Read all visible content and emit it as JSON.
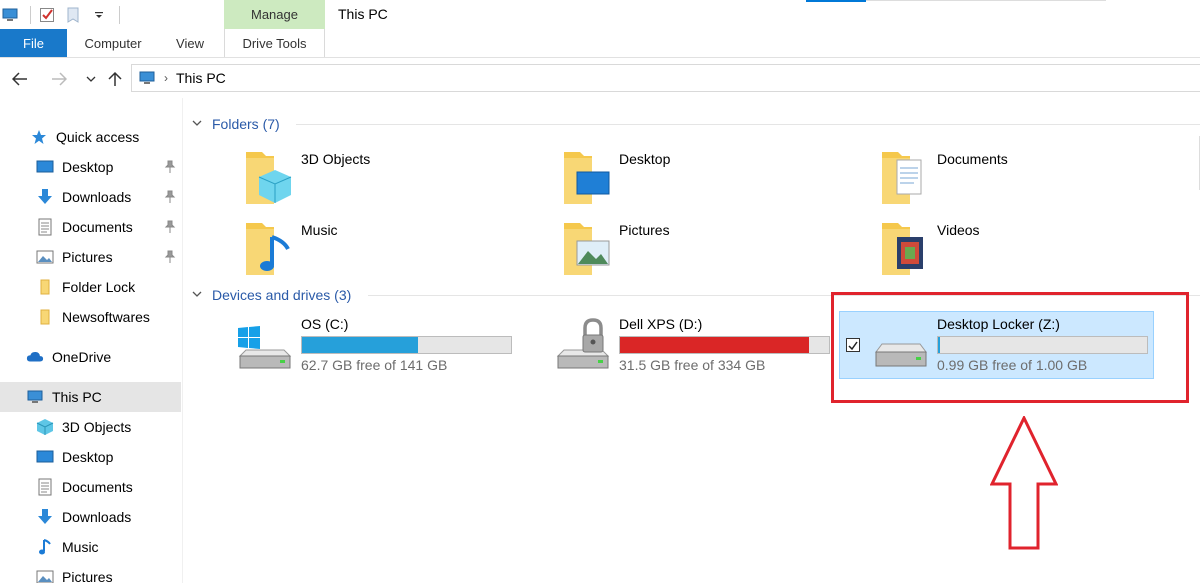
{
  "window": {
    "title": "This PC",
    "manage_tab": "Manage"
  },
  "ribbon": {
    "tabs": [
      {
        "label": "File"
      },
      {
        "label": "Computer"
      },
      {
        "label": "View"
      },
      {
        "label": "Drive Tools"
      }
    ]
  },
  "address": {
    "crumb": "This PC"
  },
  "sidebar": {
    "items": [
      {
        "label": "Quick access",
        "icon": "star-icon",
        "pinned": false
      },
      {
        "label": "Desktop",
        "icon": "desktop-icon",
        "pinned": true
      },
      {
        "label": "Downloads",
        "icon": "download-arrow-icon",
        "pinned": true
      },
      {
        "label": "Documents",
        "icon": "document-icon",
        "pinned": true
      },
      {
        "label": "Pictures",
        "icon": "pictures-icon",
        "pinned": true
      },
      {
        "label": "Folder Lock",
        "icon": "folder-icon",
        "pinned": false
      },
      {
        "label": "Newsoftwares",
        "icon": "folder-icon",
        "pinned": false
      },
      {
        "label": "OneDrive",
        "icon": "cloud-icon",
        "pinned": false
      },
      {
        "label": "This PC",
        "icon": "computer-icon",
        "pinned": false,
        "selected": true
      },
      {
        "label": "3D Objects",
        "icon": "cube-icon",
        "pinned": false
      },
      {
        "label": "Desktop",
        "icon": "desktop-icon",
        "pinned": false
      },
      {
        "label": "Documents",
        "icon": "document-icon",
        "pinned": false
      },
      {
        "label": "Downloads",
        "icon": "download-arrow-icon",
        "pinned": false
      },
      {
        "label": "Music",
        "icon": "music-note-icon",
        "pinned": false
      },
      {
        "label": "Pictures",
        "icon": "pictures-icon",
        "pinned": false
      }
    ]
  },
  "folders_group": {
    "label": "Folders (7)",
    "items": [
      {
        "label": "3D Objects",
        "icon": "folder-3d-objects-icon"
      },
      {
        "label": "Desktop",
        "icon": "folder-desktop-icon"
      },
      {
        "label": "Documents",
        "icon": "folder-documents-icon"
      },
      {
        "label": "Music",
        "icon": "folder-music-icon"
      },
      {
        "label": "Pictures",
        "icon": "folder-pictures-icon"
      },
      {
        "label": "Videos",
        "icon": "folder-videos-icon"
      }
    ]
  },
  "drives_group": {
    "label": "Devices and drives (3)",
    "items": [
      {
        "label": "OS (C:)",
        "free_text": "62.7 GB free of 141 GB",
        "used_fraction": 0.555,
        "bar_color": "#26a0da",
        "icon": "windows-drive-icon"
      },
      {
        "label": "Dell XPS (D:)",
        "free_text": "31.5 GB free of 334 GB",
        "used_fraction": 0.906,
        "bar_color": "#da2626",
        "icon": "locked-drive-icon"
      },
      {
        "label": "Desktop Locker (Z:)",
        "free_text": "0.99 GB free of 1.00 GB",
        "used_fraction": 0.01,
        "bar_color": "#26a0da",
        "icon": "drive-icon",
        "selected": true,
        "checked": true
      }
    ]
  },
  "colors": {
    "accent": "#0078d7",
    "file_tab": "#1979ca",
    "manage_tab": "#cdeac0",
    "annotation_red": "#e0232d",
    "selection": "#cce8ff"
  }
}
